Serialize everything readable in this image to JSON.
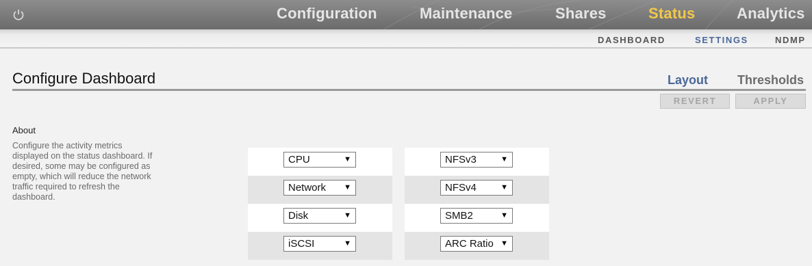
{
  "colors": {
    "accent": "#f2c84b",
    "link_active": "#4a6899",
    "topbar": "#7a7a7a"
  },
  "topbar": {
    "power_icon": "power-icon",
    "nav": [
      {
        "label": "Configuration",
        "active": false
      },
      {
        "label": "Maintenance",
        "active": false
      },
      {
        "label": "Shares",
        "active": false
      },
      {
        "label": "Status",
        "active": true
      },
      {
        "label": "Analytics",
        "active": false
      }
    ]
  },
  "subnav": [
    {
      "label": "DASHBOARD",
      "active": false
    },
    {
      "label": "SETTINGS",
      "active": true
    },
    {
      "label": "NDMP",
      "active": false
    }
  ],
  "page": {
    "title": "Configure Dashboard",
    "tabs": [
      {
        "label": "Layout",
        "active": true
      },
      {
        "label": "Thresholds",
        "active": false
      }
    ],
    "buttons": {
      "revert": "REVERT",
      "apply": "APPLY"
    }
  },
  "about": {
    "heading": "About",
    "text": "Configure the activity metrics displayed on the status dashboard. If desired, some may be configured as empty, which will reduce the network traffic required to refresh the dashboard."
  },
  "grid": {
    "left": [
      "CPU",
      "Network",
      "Disk",
      "iSCSI"
    ],
    "right": [
      "NFSv3",
      "NFSv4",
      "SMB2",
      "ARC Ratio"
    ],
    "dropdown_icon": "dropdown-arrow-icon"
  }
}
